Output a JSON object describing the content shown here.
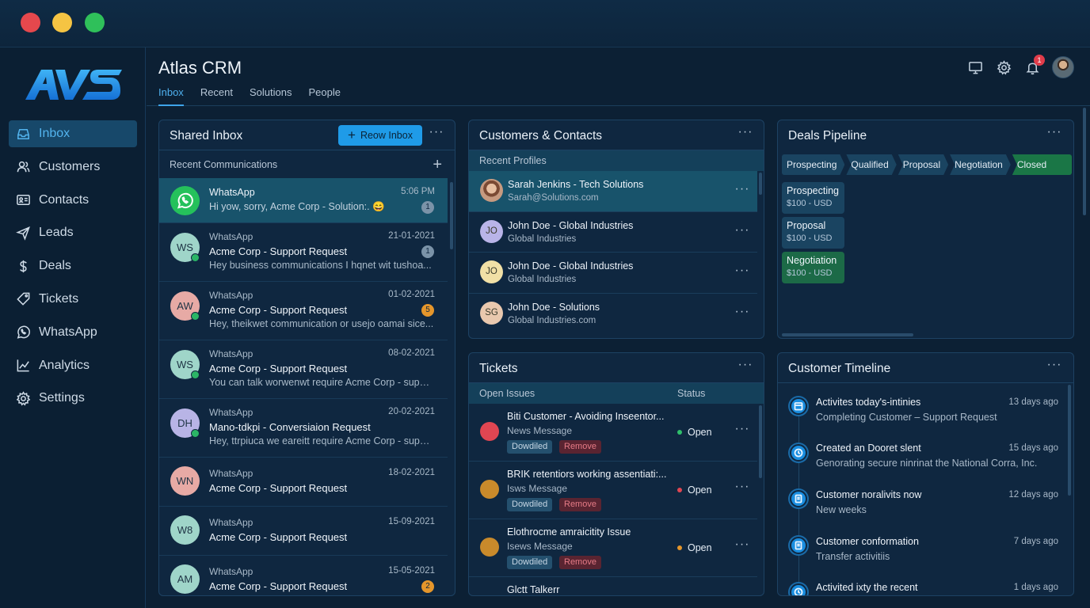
{
  "window": {
    "title_dots": [
      "#e5484d",
      "#f5c443",
      "#2fc05a"
    ]
  },
  "brand": {
    "logo_text": "AVS"
  },
  "sidebar": {
    "items": [
      {
        "label": "Inbox",
        "icon": "inbox-icon",
        "active": true
      },
      {
        "label": "Customers",
        "icon": "users-icon"
      },
      {
        "label": "Contacts",
        "icon": "id-card-icon"
      },
      {
        "label": "Leads",
        "icon": "send-icon"
      },
      {
        "label": "Deals",
        "icon": "dollar-icon"
      },
      {
        "label": "Tickets",
        "icon": "ticket-icon"
      },
      {
        "label": "WhatsApp",
        "icon": "whatsapp-icon"
      },
      {
        "label": "Analytics",
        "icon": "chart-icon"
      },
      {
        "label": "Settings",
        "icon": "gear-icon"
      }
    ]
  },
  "header": {
    "title": "Atlas CRM",
    "tabs": [
      "Inbox",
      "Recent",
      "Solutions",
      "People"
    ],
    "notification_count": "1",
    "icons": [
      "monitor-icon",
      "gear-icon",
      "bell-icon",
      "avatar"
    ]
  },
  "shared_inbox": {
    "title": "Shared Inbox",
    "new_button": "Reow Inbox",
    "subheader": "Recent Communications",
    "messages": [
      {
        "source": "WhatsApp",
        "subject": "",
        "preview": "Hi yow, sorry, Acme Corp - Solution:. 😄",
        "date": "5:06 PM",
        "count": "1",
        "avatar": "",
        "avatar_color": "#25c15b",
        "count_color": "#7b93a8"
      },
      {
        "source": "WhatsApp",
        "subject": "Acme Corp - Support Request",
        "preview": "Hey business communications I hqnet wit tushoa...",
        "date": "21-01-2021",
        "count": "1",
        "avatar": "WS",
        "avatar_color": "#9fd5c9",
        "count_color": "#7b93a8"
      },
      {
        "source": "WhatsApp",
        "subject": "Acme Corp - Support Request",
        "preview": "Hey, theikwet communication or usejo oamai sice...",
        "date": "01-02-2021",
        "count": "5",
        "avatar": "AW",
        "avatar_color": "#e7aaa5",
        "count_color": "#e5962b"
      },
      {
        "source": "WhatsApp",
        "subject": "Acme Corp - Support Request",
        "preview": "You can talk worwenwt require Acme Corp - suppo...",
        "date": "08-02-2021",
        "count": "",
        "avatar": "WS",
        "avatar_color": "#9fd5c9",
        "count_color": ""
      },
      {
        "source": "WhatsApp",
        "subject": "Mano-tdkpi - Conversiaion Request",
        "preview": "Hey, ttrpiuca we eareitt require Acme Corp - suppoc...",
        "date": "20-02-2021",
        "count": "",
        "avatar": "DH",
        "avatar_color": "#b8b4e6",
        "count_color": ""
      },
      {
        "source": "WhatsApp",
        "subject": "Acme Corp - Support Request",
        "preview": "",
        "date": "18-02-2021",
        "count": "",
        "avatar": "WN",
        "avatar_color": "#e7aaa5",
        "count_color": ""
      },
      {
        "source": "WhatsApp",
        "subject": "Acme Corp - Support Request",
        "preview": "",
        "date": "15-09-2021",
        "count": "",
        "avatar": "W8",
        "avatar_color": "#9fd5c9",
        "count_color": ""
      },
      {
        "source": "WhatsApp",
        "subject": "Acme Corp - Support Request",
        "preview": "",
        "date": "15-05-2021",
        "count": "2",
        "avatar": "AM",
        "avatar_color": "#9fd5c9",
        "count_color": "#e5962b"
      }
    ]
  },
  "customers": {
    "title": "Customers & Contacts",
    "subheader": "Recent Profiles",
    "profiles": [
      {
        "name": "Sarah Jenkins - Tech Solutions",
        "sub": "Sarah@Solutions.com",
        "initials": "",
        "color": "#d9b89c"
      },
      {
        "name": "John Doe - Global Industries",
        "sub": "Global Industries",
        "initials": "JO",
        "color": "#b9b4e8"
      },
      {
        "name": "John Doe - Global Industries",
        "sub": "Global Industries",
        "initials": "JO",
        "color": "#f1e0a6"
      },
      {
        "name": "John Doe - Solutions",
        "sub": "Global Industries.com",
        "initials": "SG",
        "color": "#e9c8ae"
      }
    ]
  },
  "deals": {
    "title": "Deals Pipeline",
    "stages": [
      "Prospecting",
      "Qualified",
      "Proposal",
      "Negotiation",
      "Closed Won"
    ],
    "cards": [
      {
        "name": "Prospecting",
        "value": "$100 - USD"
      },
      {
        "name": "Proposal",
        "value": "$100 - USD"
      },
      {
        "name": "Negotiation",
        "value": "$100 - USD"
      }
    ]
  },
  "tickets": {
    "title": "Tickets",
    "col_issues": "Open Issues",
    "col_status": "Status",
    "tag_download": "Dowdiled",
    "tag_remove": "Remove",
    "items": [
      {
        "title": "Biti Customer - Avoiding Inseentor...",
        "sub": "News Message",
        "status": "Open",
        "icon_color": "#e04652",
        "dot_color": "#2fbf6b"
      },
      {
        "title": "BRIK retentiors working assentiati:...",
        "sub": "Isws Message",
        "status": "Open",
        "icon_color": "#c98a2b",
        "dot_color": "#e04652"
      },
      {
        "title": "Elothrocme amraicitity Issue",
        "sub": "Isews Message",
        "status": "Open",
        "icon_color": "#c98a2b",
        "dot_color": "#e5962b"
      },
      {
        "title": "Glctt Talkerr",
        "sub": "",
        "status": "",
        "icon_color": "",
        "dot_color": ""
      }
    ]
  },
  "timeline": {
    "title": "Customer Timeline",
    "items": [
      {
        "title": "Activites today's-intinies",
        "sub": "Completing Customer – Support Request",
        "time": "13 days ago",
        "icon": "calendar-icon"
      },
      {
        "title": "Created an Dooret slent",
        "sub": "Genorating secure ninrinat the National Corra, Inc.",
        "time": "15 days ago",
        "icon": "clock-icon"
      },
      {
        "title": "Customer noralivits now",
        "sub": "New weeks",
        "time": "12 days ago",
        "icon": "document-icon"
      },
      {
        "title": "Customer conformation",
        "sub": "Transfer activitiis",
        "time": "7 days ago",
        "icon": "document-icon"
      },
      {
        "title": "Activited ixty the recent",
        "sub": "",
        "time": "1 days ago",
        "icon": "clock-icon"
      }
    ]
  }
}
